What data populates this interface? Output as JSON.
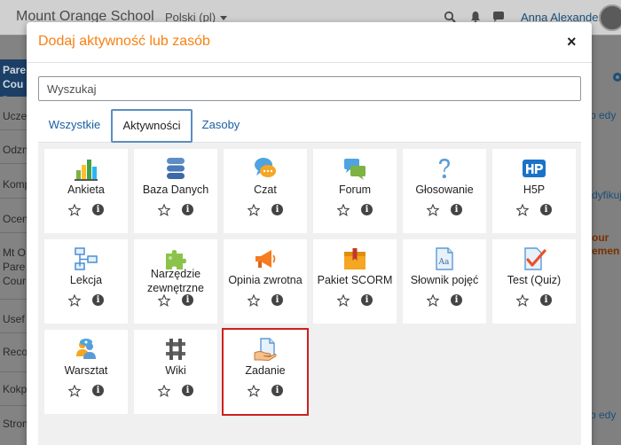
{
  "background": {
    "site_name": "Mount Orange School",
    "language": "Polski (pl)",
    "user_name": "Anna Alexander",
    "drawer_items": [
      "Pare Cour",
      "Ucze",
      "Odzn",
      "Komp",
      "Ocen",
      "Mt O Pare Cour",
      "Usef",
      "Reco",
      "Kokp",
      "Stron"
    ],
    "right_texts": [
      "b edy",
      "dyfikuj",
      "our",
      "emen",
      "b edy"
    ]
  },
  "modal": {
    "title": "Dodaj aktywność lub zasób",
    "close_label": "×"
  },
  "search": {
    "placeholder": "Wyszukaj",
    "value": ""
  },
  "tabs": [
    {
      "label": "Wszystkie",
      "active": false
    },
    {
      "label": "Aktywności",
      "active": true
    },
    {
      "label": "Zasoby",
      "active": false
    }
  ],
  "tiles": [
    {
      "label": "Ankieta",
      "icon": "survey-chart-icon"
    },
    {
      "label": "Baza Danych",
      "icon": "database-icon"
    },
    {
      "label": "Czat",
      "icon": "chat-icon"
    },
    {
      "label": "Forum",
      "icon": "forum-icon"
    },
    {
      "label": "Głosowanie",
      "icon": "question-icon"
    },
    {
      "label": "H5P",
      "icon": "h5p-icon"
    },
    {
      "label": "Lekcja",
      "icon": "lesson-icon"
    },
    {
      "label": "Narzędzie zewnętrzne",
      "icon": "puzzle-icon"
    },
    {
      "label": "Opinia zwrotna",
      "icon": "megaphone-icon"
    },
    {
      "label": "Pakiet SCORM",
      "icon": "scorm-package-icon"
    },
    {
      "label": "Słownik pojęć",
      "icon": "glossary-icon"
    },
    {
      "label": "Test (Quiz)",
      "icon": "quiz-checkmark-icon"
    },
    {
      "label": "Warsztat",
      "icon": "workshop-icon"
    },
    {
      "label": "Wiki",
      "icon": "wiki-icon"
    },
    {
      "label": "Zadanie",
      "icon": "assignment-icon",
      "selected": true
    }
  ],
  "tile_actions": {
    "star": "star-icon",
    "info": "i"
  },
  "colors": {
    "title": "#f98012",
    "link": "#1a5fa3",
    "selected_outline": "#cf1f1f",
    "active_tab_border": "#5a8ec2"
  }
}
